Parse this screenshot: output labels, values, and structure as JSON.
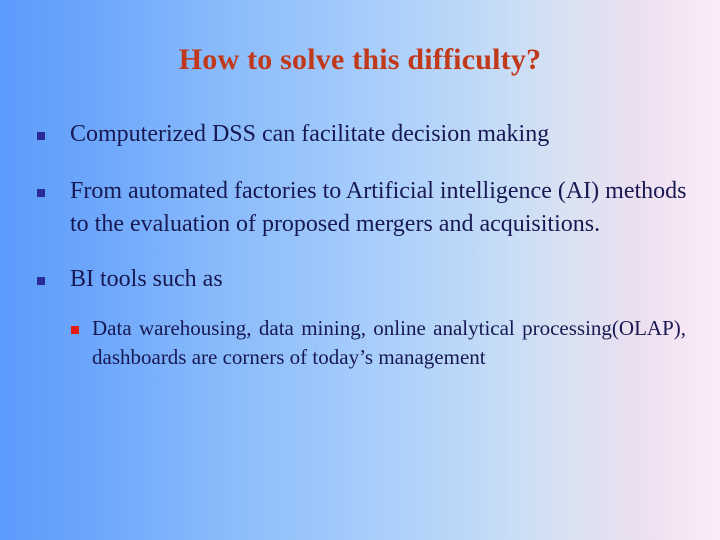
{
  "slide": {
    "title": "How to solve this difficulty?",
    "title_color": "#c0391b",
    "text_color": "#181853",
    "background_left_color": "#5b9bfc",
    "background_right_color": "#fcebf8",
    "bullet_marker_color": "#2a2a96",
    "sub_bullet_marker_color": "#e01b10",
    "bullets": [
      {
        "text": "Computerized DSS can facilitate decision making"
      },
      {
        "text": "From automated factories to Artificial intelligence (AI) methods to the evaluation of proposed mergers and acquisitions."
      },
      {
        "text": "BI tools such as"
      }
    ],
    "sub_bullets": [
      {
        "text": "Data warehousing, data mining, online analytical processing(OLAP), dashboards are corners of today’s management"
      }
    ]
  }
}
